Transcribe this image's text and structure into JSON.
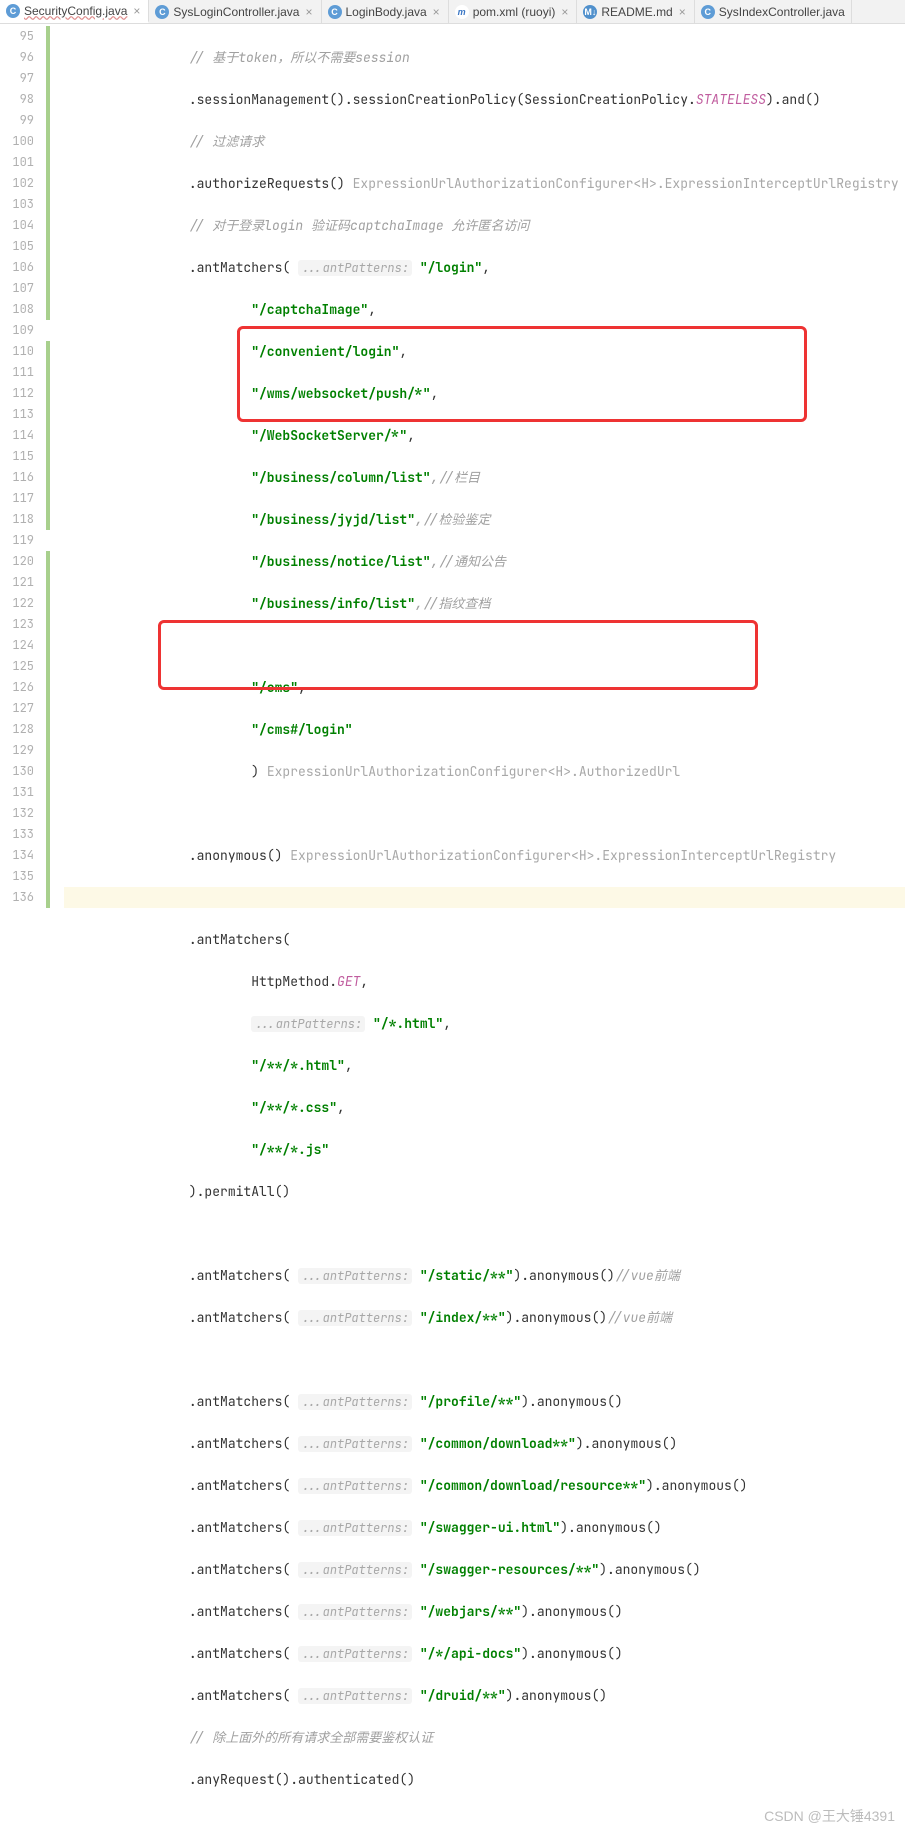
{
  "tabs": [
    {
      "label": "SecurityConfig.java",
      "icon": "C",
      "iclass": "ic-c",
      "active": true,
      "wavy": true
    },
    {
      "label": "SysLoginController.java",
      "icon": "C",
      "iclass": "ic-c"
    },
    {
      "label": "LoginBody.java",
      "icon": "C",
      "iclass": "ic-c"
    },
    {
      "label": "pom.xml (ruoyi)",
      "icon": "m",
      "iclass": "ic-m"
    },
    {
      "label": "README.md",
      "icon": "MD",
      "iclass": "ic-md"
    },
    {
      "label": "SysIndexController.java",
      "icon": "C",
      "iclass": "ic-c"
    }
  ],
  "lines": {
    "n95": "95",
    "n96": "96",
    "n97": "97",
    "n98": "98",
    "n99": "99",
    "n100": "100",
    "n101": "101",
    "n102": "102",
    "n103": "103",
    "n104": "104",
    "n105": "105",
    "n106": "106",
    "n107": "107",
    "n108": "108",
    "n109": "109",
    "n110": "110",
    "n111": "111",
    "n112": "112",
    "n113": "113",
    "n114": "114",
    "n115": "115",
    "n116": "116",
    "n117": "117",
    "n118": "118",
    "n119": "119",
    "n120": "120",
    "n121": "121",
    "n122": "122",
    "n123": "123",
    "n124": "124",
    "n125": "125",
    "n126": "126",
    "n127": "127",
    "n128": "128",
    "n129": "129",
    "n130": "130",
    "n131": "131",
    "n132": "132",
    "n133": "133",
    "n134": "134",
    "n135": "135",
    "n136": "136"
  },
  "c": {
    "l95": "// 基于token，所以不需要session",
    "l96a": ".sessionManagement().sessionCreationPolicy(SessionCreationPolicy.",
    "l96b": "STATELESS",
    "l96c": ").and()",
    "l97": "// 过滤请求",
    "l98a": ".authorizeRequests() ",
    "l98b": "ExpressionUrlAuthorizationConfigurer<H>.ExpressionInterceptUrlRegistry",
    "l99": "// 对于登录login 验证码captchaImage 允许匿名访问",
    "l100a": ".antMatchers( ",
    "l100h": "...antPatterns:",
    "l100b": " \"/login\"",
    "l100c": ",",
    "l101": "\"/captchaImage\"",
    "l102": "\"/convenient/login\"",
    "l103": "\"/wms/websocket/push/*\"",
    "l104": "\"/WebSocketServer/*\"",
    "l105a": "\"/business/column/list\"",
    "l105c": ",//栏目",
    "l106a": "\"/business/jyjd/list\"",
    "l106c": ",//检验鉴定",
    "l107a": "\"/business/notice/list\"",
    "l107c": ",//通知公告",
    "l108a": "\"/business/info/list\"",
    "l108c": ",//指纹查档",
    "l110": "\"/cms\"",
    "l111": "\"/cms#/login\"",
    "l112a": ") ",
    "l112b": "ExpressionUrlAuthorizationConfigurer<H>.AuthorizedUrl",
    "l114a": ".anonymous() ",
    "l114b": "ExpressionUrlAuthorizationConfigurer<H>.ExpressionInterceptUrlRegistry",
    "l116": ".antMatchers(",
    "l117a": "HttpMethod.",
    "l117b": "GET",
    "l117c": ",",
    "l118h": "...antPatterns:",
    "l118b": " \"/*.html\"",
    "l119": "\"/**/*.html\"",
    "l120": "\"/**/*.css\"",
    "l121": "\"/**/*.js\"",
    "l122": ").permitAll()",
    "l124a": ".antMatchers( ",
    "l124b": " \"/static/**\"",
    "l124c": ").anonymous()",
    "l124d": "//vue前端",
    "l125b": " \"/index/**\"",
    "l125c": ").anonymous()",
    "l125d": "//vue前端",
    "l127b": " \"/profile/**\"",
    "l127c": ").anonymous()",
    "l128b": " \"/common/download**\"",
    "l128c": ").anonymous()",
    "l129b": " \"/common/download/resource**\"",
    "l129c": ").anonymous()",
    "l130b": " \"/swagger-ui.html\"",
    "l130c": ").anonymous()",
    "l131b": " \"/swagger-resources/**\"",
    "l131c": ").anonymous()",
    "l132b": " \"/webjars/**\"",
    "l132c": ").anonymous()",
    "l133b": " \"/*/api-docs\"",
    "l133c": ").anonymous()",
    "l134b": " \"/druid/**\"",
    "l134c": ").anonymous()",
    "l135": "// 除上面外的所有请求全部需要鉴权认证",
    "l136": ".anyRequest().authenticated()"
  },
  "hint_ant": "...antPatterns:",
  "comma": ",",
  "watermark": "CSDN @王大锤4391"
}
